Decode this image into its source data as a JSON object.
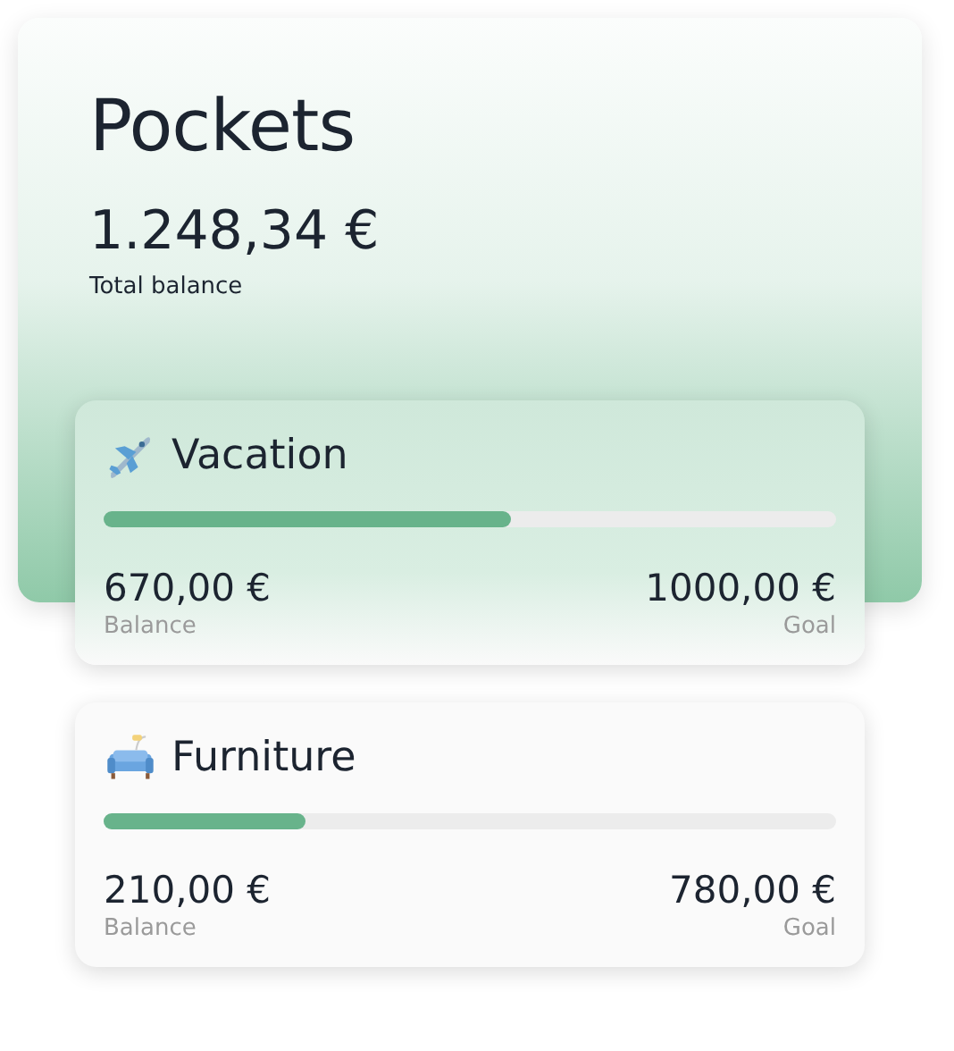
{
  "header": {
    "title": "Pockets",
    "total": "1.248,34 €",
    "total_label": "Total balance"
  },
  "pockets": [
    {
      "kind": "airplane",
      "name": "Vacation",
      "level": 0.555,
      "balance": "670,00 €",
      "balance_label": "Balance",
      "goal": "1000,00 €",
      "goal_label": "Goal",
      "highlighted": true
    },
    {
      "kind": "sofa",
      "name": "Furniture",
      "level": 0.275,
      "balance": "210,00 €",
      "balance_label": "Balance",
      "goal": "780,00 €",
      "goal_label": "Goal",
      "highlighted": false
    }
  ]
}
